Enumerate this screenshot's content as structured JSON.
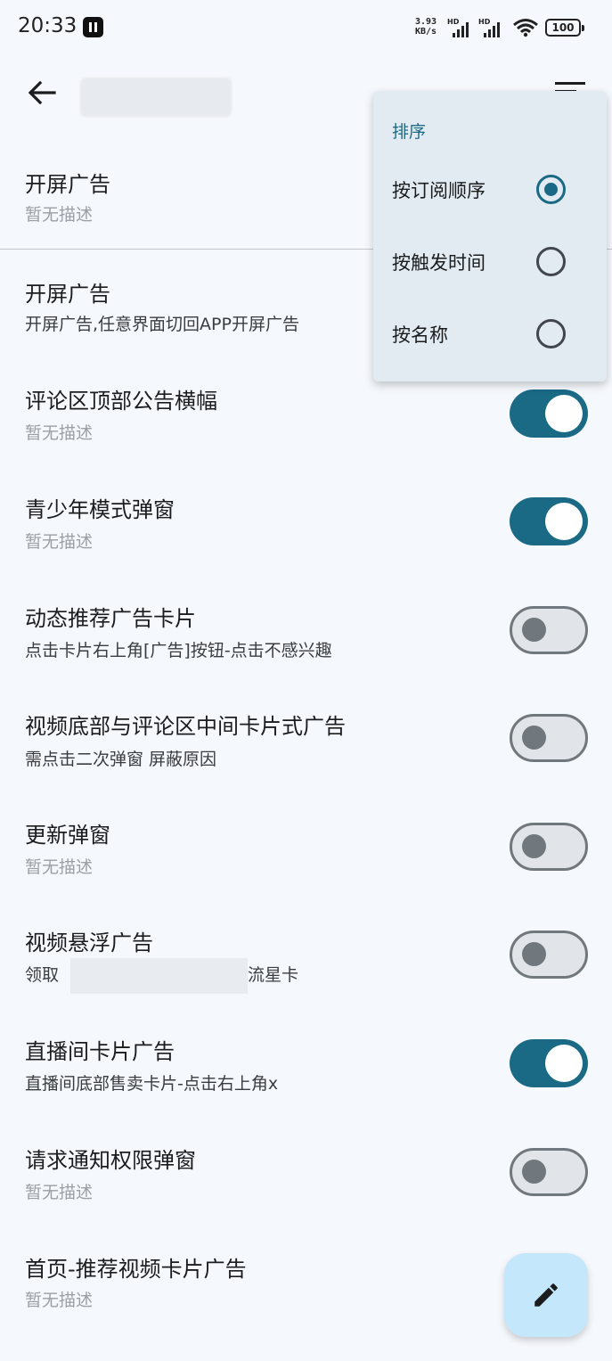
{
  "status_bar": {
    "time": "20:33",
    "net_speed_value": "3.93",
    "net_speed_unit": "KB/s",
    "sim1_label": "HD",
    "sim2_label": "HD",
    "battery": "100"
  },
  "sort_menu": {
    "header": "排序",
    "options": [
      {
        "label": "按订阅顺序",
        "selected": true
      },
      {
        "label": "按触发时间",
        "selected": false
      },
      {
        "label": "按名称",
        "selected": false
      }
    ]
  },
  "group": {
    "title": "开屏广告",
    "desc": "暂无描述"
  },
  "rules": [
    {
      "title": "开屏广告",
      "desc": "开屏广告,任意界面切回APP开屏广告",
      "enabled": null
    },
    {
      "title": "评论区顶部公告横幅",
      "desc": "暂无描述",
      "enabled": true
    },
    {
      "title": "青少年模式弹窗",
      "desc": "暂无描述",
      "enabled": true
    },
    {
      "title": "动态推荐广告卡片",
      "desc": "点击卡片右上角[广告]按钮-点击不感兴趣",
      "enabled": false
    },
    {
      "title": "视频底部与评论区中间卡片式广告",
      "desc": "需点击二次弹窗 屏蔽原因",
      "enabled": false
    },
    {
      "title": "更新弹窗",
      "desc": "暂无描述",
      "enabled": false
    },
    {
      "title": "视频悬浮广告",
      "desc": "领取",
      "desc_suffix": "流星卡",
      "enabled": false
    },
    {
      "title": "直播间卡片广告",
      "desc": "直播间底部售卖卡片-点击右上角x",
      "enabled": true
    },
    {
      "title": "请求通知权限弹窗",
      "desc": "暂无描述",
      "enabled": false
    },
    {
      "title": "首页-推荐视频卡片广告",
      "desc": "暂无描述",
      "enabled": null
    }
  ],
  "colors": {
    "accent": "#1a6985",
    "background": "#f5f8fc",
    "fab": "#c5e7fb",
    "muted_text": "#9aa0a6"
  },
  "icons": {
    "back": "arrow-left-icon",
    "menu": "sort-menu-icon",
    "fab": "edit-pencil-icon"
  }
}
